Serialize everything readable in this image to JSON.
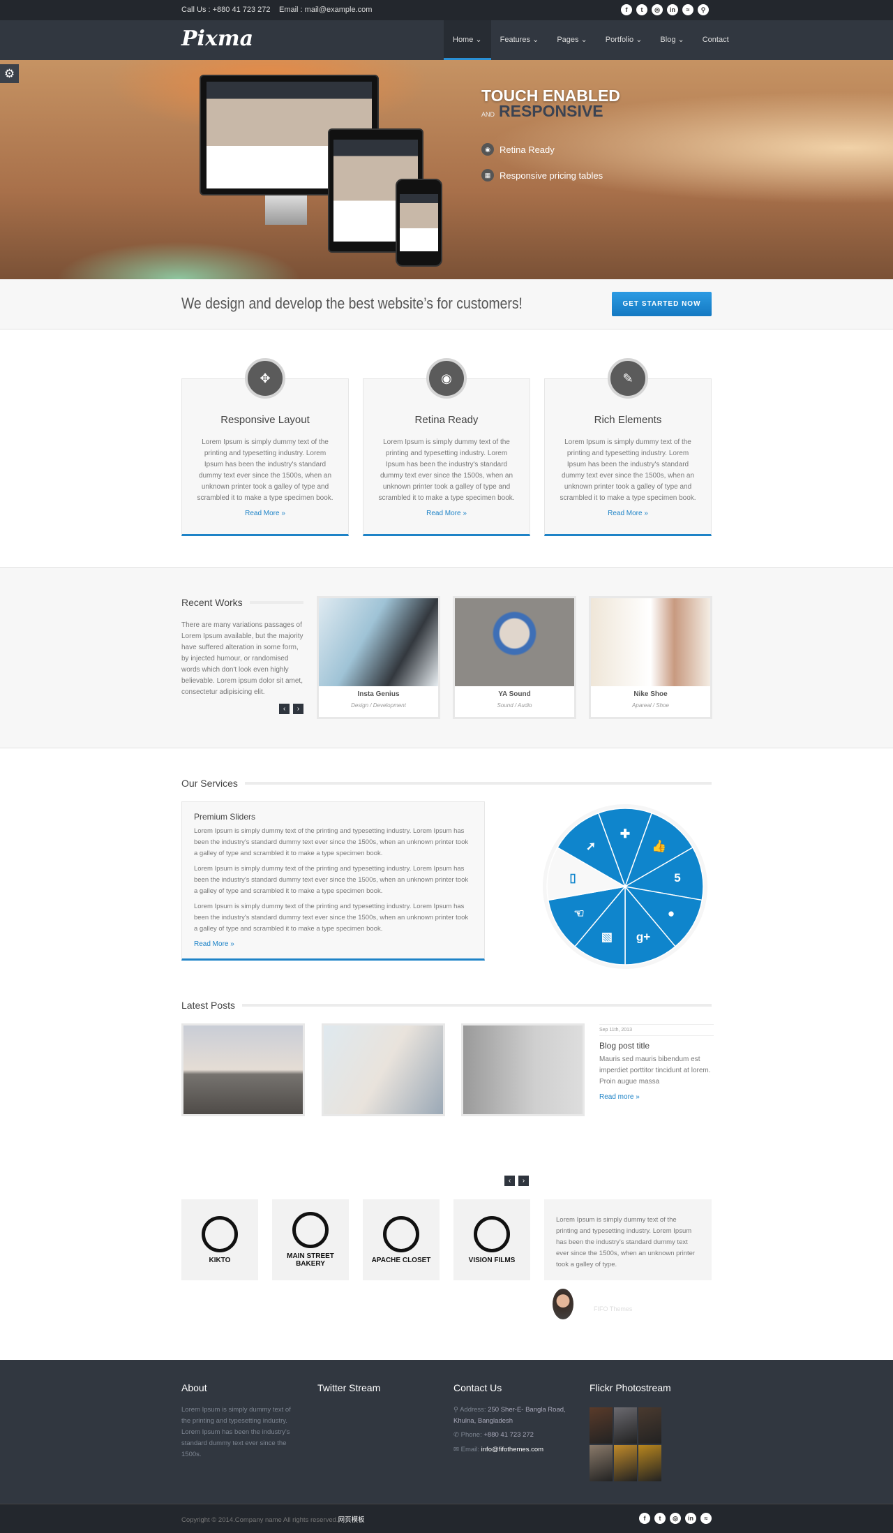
{
  "topbar": {
    "phone": "Call Us : +880 41 723 272",
    "email": "Email : mail@example.com",
    "social": [
      "facebook",
      "twitter",
      "dribbble",
      "linkedin",
      "rss",
      "search"
    ]
  },
  "nav": {
    "logo": "Pixma",
    "items": [
      "Home",
      "Features",
      "Pages",
      "Portfolio",
      "Blog",
      "Contact"
    ],
    "active": "Home"
  },
  "hero": {
    "title1": "TOUCH ENABLED",
    "and": "AND",
    "title2": "RESPONSIVE",
    "features": [
      "Retina Ready",
      "Responsive pricing tables"
    ]
  },
  "cta": {
    "text": "We design and develop the best website’s for customers!",
    "button": "GET STARTED NOW"
  },
  "features": [
    {
      "icon": "expand-icon",
      "title": "Responsive Layout",
      "text": "Lorem Ipsum is simply dummy text of the printing and typesetting industry. Lorem Ipsum has been the industry's standard dummy text ever since the 1500s, when an unknown printer took a galley of type and scrambled it to make a type specimen book.",
      "link": "Read More »"
    },
    {
      "icon": "eye-icon",
      "title": "Retina Ready",
      "text": "Lorem Ipsum is simply dummy text of the printing and typesetting industry. Lorem Ipsum has been the industry's standard dummy text ever since the 1500s, when an unknown printer took a galley of type and scrambled it to make a type specimen book.",
      "link": "Read More »"
    },
    {
      "icon": "edit-icon",
      "title": "Rich Elements",
      "text": "Lorem Ipsum is simply dummy text of the printing and typesetting industry. Lorem Ipsum has been the industry's standard dummy text ever since the 1500s, when an unknown printer took a galley of type and scrambled it to make a type specimen book.",
      "link": "Read More »"
    }
  ],
  "works": {
    "title": "Recent Works",
    "text": "There are many variations passages of Lorem Ipsum available, but the majority have suffered alteration in some form, by injected humour, or randomised words which don't look even highly believable. Lorem ipsum dolor sit amet, consectetur adipisicing elit.",
    "items": [
      {
        "name": "Insta Genius",
        "cat": "Design / Development"
      },
      {
        "name": "YA Sound",
        "cat": "Sound / Audio"
      },
      {
        "name": "Nike Shoe",
        "cat": "Apareal / Shoe"
      }
    ]
  },
  "services": {
    "title": "Our Services",
    "item_title": "Premium Sliders",
    "paragraphs": [
      "Lorem Ipsum is simply dummy text of the printing and typesetting industry. Lorem Ipsum has been the industry's standard dummy text ever since the 1500s, when an unknown printer took a galley of type and scrambled it to make a type specimen book.",
      "Lorem Ipsum is simply dummy text of the printing and typesetting industry. Lorem Ipsum has been the industry's standard dummy text ever since the 1500s, when an unknown printer took a galley of type and scrambled it to make a type specimen book.",
      "Lorem Ipsum is simply dummy text of the printing and typesetting industry. Lorem Ipsum has been the industry's standard dummy text ever since the 1500s, when an unknown printer took a galley of type and scrambled it to make a type specimen book."
    ],
    "link": "Read More »",
    "wheel": [
      {
        "icon": "puzzle-icon",
        "glyph": "✚"
      },
      {
        "icon": "thumbs-up-icon",
        "glyph": "👍"
      },
      {
        "icon": "html5-icon",
        "glyph": "5"
      },
      {
        "icon": "shapes-icon",
        "glyph": "●"
      },
      {
        "icon": "google-plus-icon",
        "glyph": "g+"
      },
      {
        "icon": "picture-icon",
        "glyph": "▧"
      },
      {
        "icon": "hand-icon",
        "glyph": "☜"
      },
      {
        "icon": "mobile-icon",
        "glyph": "▯"
      },
      {
        "icon": "rocket-icon",
        "glyph": "➚"
      }
    ],
    "active_index": 7,
    "accent": "#0f85cc"
  },
  "posts": {
    "title": "Latest Posts",
    "date": "Sep 11th, 2013",
    "post_title": "Blog post title",
    "excerpt": "Mauris sed mauris bibendum est imperdiet porttitor tincidunt at lorem. Proin augue massa",
    "link": "Read more »"
  },
  "clients": {
    "logos": [
      "KIKTO",
      "MAIN STREET BAKERY",
      "APACHE CLOSET",
      "VISION FILMS"
    ],
    "testimonial": "Lorem Ipsum is simply dummy text of the printing and typesetting industry. Lorem Ipsum has been the industry's standard dummy text ever since the 1500s, when an unknown printer took a galley of type.",
    "author": "FIFO Themes"
  },
  "footer": {
    "about_title": "About",
    "about_text": "Lorem Ipsum is simply dummy text of the printing and typesetting industry. Lorem Ipsum has been the industry's standard dummy text ever since the 1500s.",
    "twitter_title": "Twitter Stream",
    "contact_title": "Contact Us",
    "address_label": "Address:",
    "address": "250 Sher-E- Bangla Road, Khulna, Bangladesh",
    "phone_label": "Phone:",
    "phone": "+880 41 723 272",
    "email_label": "Email:",
    "email": "info@fifothemes.com",
    "flickr_title": "Flickr Photostream",
    "copyright": "Copyright © 2014.Company name All rights reserved.",
    "copyright_link": "网页模板"
  }
}
